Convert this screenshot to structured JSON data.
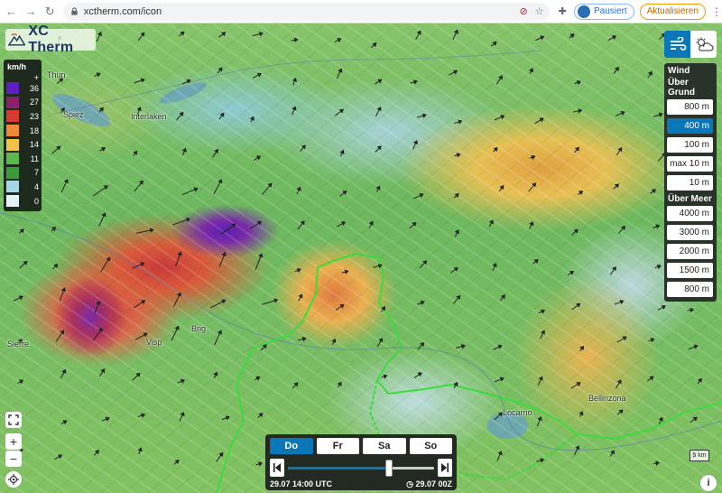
{
  "browser": {
    "url": "xctherm.com/icon",
    "paused_label": "Pausiert",
    "update_label": "Aktualisieren",
    "icons": [
      "back-icon",
      "forward-icon",
      "reload-icon",
      "lock-icon",
      "camera-blocked-icon",
      "star-icon",
      "puzzle-icon",
      "menu-icon"
    ]
  },
  "app": {
    "title": "XC Therm"
  },
  "legend": {
    "unit": "km/h",
    "plus_label": "+",
    "items": [
      {
        "value": "36",
        "color": "#5b1fc4"
      },
      {
        "value": "27",
        "color": "#8b1f6a"
      },
      {
        "value": "23",
        "color": "#d63b2f"
      },
      {
        "value": "18",
        "color": "#ee8a34"
      },
      {
        "value": "14",
        "color": "#f1c348"
      },
      {
        "value": "11",
        "color": "#5db84c"
      },
      {
        "value": "7",
        "color": "#3d9a3a"
      },
      {
        "value": "4",
        "color": "#a8d6e6"
      },
      {
        "value": "0",
        "color": "#e6f2f6"
      }
    ]
  },
  "modes": {
    "wind_icon": "wind-icon",
    "thermal_icon": "sun-cloud-icon"
  },
  "wind_panel": {
    "title": "Wind",
    "above_ground_label": "Über Grund",
    "above_ground_levels": [
      "800 m",
      "400 m",
      "100 m",
      "max 10 m",
      "10 m"
    ],
    "above_ground_active": 1,
    "above_sea_label": "Über Meer",
    "above_sea_levels": [
      "4000 m",
      "3000 m",
      "2000 m",
      "1500 m",
      "800 m"
    ]
  },
  "places": [
    {
      "name": "Thun"
    },
    {
      "name": "Spiez"
    },
    {
      "name": "Interlaken"
    },
    {
      "name": "Sierre"
    },
    {
      "name": "Visp"
    },
    {
      "name": "Brig"
    },
    {
      "name": "Locarno"
    },
    {
      "name": "Bellinzona"
    }
  ],
  "timebar": {
    "days": [
      "Do",
      "Fr",
      "Sa",
      "So"
    ],
    "active_day": 0,
    "start_label": "29.07 14:00 UTC",
    "end_label": "29.07 00Z",
    "progress": 0.69
  },
  "scale": {
    "label": "5 km"
  },
  "colors": {
    "accent": "#0b76b8",
    "panel_bg": "#2a332a",
    "border_line": "#3bdc3b"
  }
}
